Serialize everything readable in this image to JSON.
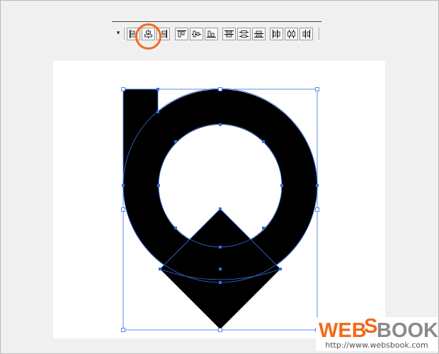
{
  "toolbar": {
    "dropdown_glyph": "▾",
    "group_align": [
      "align-left-icon",
      "align-horizontal-center-icon",
      "align-right-icon"
    ],
    "group_align_vertical": [
      "align-top-icon",
      "align-vertical-center-icon",
      "align-bottom-icon"
    ],
    "group_distribute_vertical": [
      "distribute-top-icon",
      "distribute-vertical-center-icon",
      "distribute-bottom-icon"
    ],
    "group_distribute_horizontal": [
      "distribute-left-icon",
      "distribute-horizontal-center-icon",
      "distribute-right-icon"
    ],
    "highlighted_tool": "align-horizontal-center-icon",
    "highlight_color": "#f26a1b"
  },
  "canvas": {
    "background": "#ffffff",
    "selection_color": "#2f6fe4",
    "shape_fill": "#000000"
  },
  "watermark": {
    "logo_left": "WEB",
    "logo_mid": "S",
    "logo_right": "BOOK",
    "url": "http://www.websbook.com",
    "logo_orange": "#f26a1b",
    "logo_gray": "#8a8a8a"
  }
}
